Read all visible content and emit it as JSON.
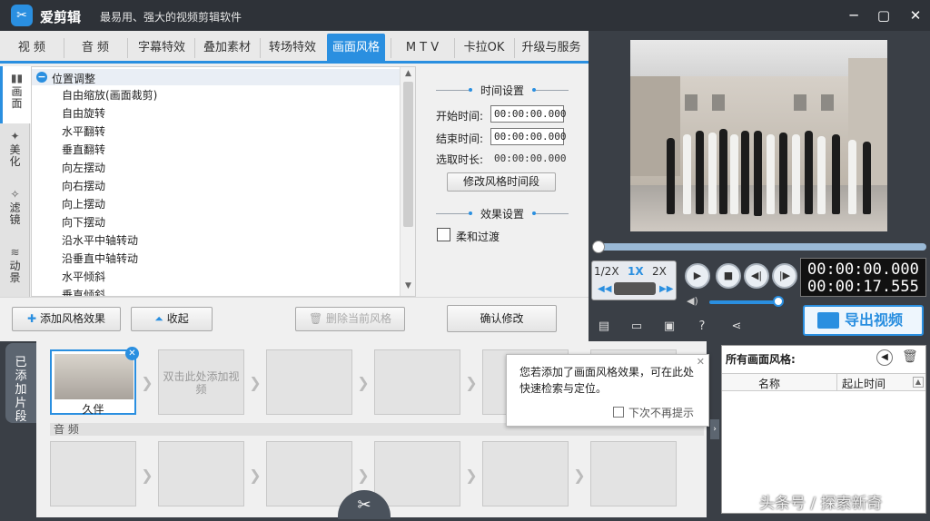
{
  "app": {
    "name": "爱剪辑",
    "slogan": "最易用、强大的视频剪辑软件"
  },
  "tabs": [
    "视 频",
    "音 频",
    "字幕特效",
    "叠加素材",
    "转场特效",
    "画面风格",
    "M T V",
    "卡拉OK",
    "升级与服务"
  ],
  "side_tabs": [
    "画面",
    "美化",
    "滤镜",
    "动景"
  ],
  "tree": {
    "group": "位置调整",
    "items": [
      "自由缩放(画面裁剪)",
      "自由旋转",
      "水平翻转",
      "垂直翻转",
      "向左摆动",
      "向右摆动",
      "向上摆动",
      "向下摆动",
      "沿水平中轴转动",
      "沿垂直中轴转动",
      "水平倾斜",
      "垂直倾斜"
    ]
  },
  "settings": {
    "time_title": "时间设置",
    "start_label": "开始时间:",
    "start_value": "00:00:00.000",
    "end_label": "结束时间:",
    "end_value": "00:00:00.000",
    "duration_label": "选取时长:",
    "duration_value": "00:00:00.000",
    "modify_button": "修改风格时间段",
    "effect_title": "效果设置",
    "smooth_label": "柔和过渡",
    "confirm_button": "确认修改"
  },
  "bottom": {
    "add_button": "添加风格效果",
    "collapse_button": "收起",
    "delete_button": "删除当前风格"
  },
  "player": {
    "speeds": [
      "1/2X",
      "1X",
      "2X"
    ],
    "current_time": "00:00:00.000",
    "total_time": "00:00:17.555",
    "export_button": "导出视频"
  },
  "timeline": {
    "label": "已添加片段",
    "clip_title": "久伴",
    "empty_hint": "双击此处添加视频",
    "audio_label": "音 频"
  },
  "popup": {
    "text": "您若添加了画面风格效果，可在此处快速检索与定位。",
    "checkbox_label": "下次不再提示"
  },
  "style_list": {
    "title": "所有画面风格:",
    "col_name": "名称",
    "col_time": "起止时间"
  },
  "watermark": "头条号 / 探索新奇",
  "colors": {
    "accent": "#2a8fe0",
    "dark_bg": "#3a3f46"
  }
}
